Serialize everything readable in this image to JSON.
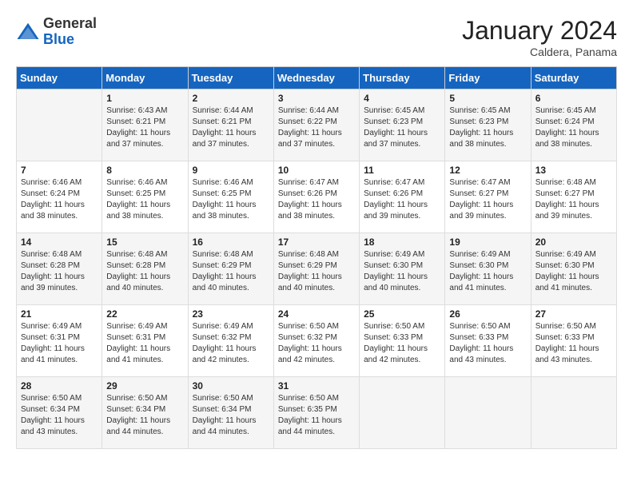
{
  "logo": {
    "general": "General",
    "blue": "Blue"
  },
  "title": "January 2024",
  "subtitle": "Caldera, Panama",
  "days_of_week": [
    "Sunday",
    "Monday",
    "Tuesday",
    "Wednesday",
    "Thursday",
    "Friday",
    "Saturday"
  ],
  "weeks": [
    [
      {
        "day": "",
        "sunrise": "",
        "sunset": "",
        "daylight": ""
      },
      {
        "day": "1",
        "sunrise": "Sunrise: 6:43 AM",
        "sunset": "Sunset: 6:21 PM",
        "daylight": "Daylight: 11 hours and 37 minutes."
      },
      {
        "day": "2",
        "sunrise": "Sunrise: 6:44 AM",
        "sunset": "Sunset: 6:21 PM",
        "daylight": "Daylight: 11 hours and 37 minutes."
      },
      {
        "day": "3",
        "sunrise": "Sunrise: 6:44 AM",
        "sunset": "Sunset: 6:22 PM",
        "daylight": "Daylight: 11 hours and 37 minutes."
      },
      {
        "day": "4",
        "sunrise": "Sunrise: 6:45 AM",
        "sunset": "Sunset: 6:23 PM",
        "daylight": "Daylight: 11 hours and 37 minutes."
      },
      {
        "day": "5",
        "sunrise": "Sunrise: 6:45 AM",
        "sunset": "Sunset: 6:23 PM",
        "daylight": "Daylight: 11 hours and 38 minutes."
      },
      {
        "day": "6",
        "sunrise": "Sunrise: 6:45 AM",
        "sunset": "Sunset: 6:24 PM",
        "daylight": "Daylight: 11 hours and 38 minutes."
      }
    ],
    [
      {
        "day": "7",
        "sunrise": "Sunrise: 6:46 AM",
        "sunset": "Sunset: 6:24 PM",
        "daylight": "Daylight: 11 hours and 38 minutes."
      },
      {
        "day": "8",
        "sunrise": "Sunrise: 6:46 AM",
        "sunset": "Sunset: 6:25 PM",
        "daylight": "Daylight: 11 hours and 38 minutes."
      },
      {
        "day": "9",
        "sunrise": "Sunrise: 6:46 AM",
        "sunset": "Sunset: 6:25 PM",
        "daylight": "Daylight: 11 hours and 38 minutes."
      },
      {
        "day": "10",
        "sunrise": "Sunrise: 6:47 AM",
        "sunset": "Sunset: 6:26 PM",
        "daylight": "Daylight: 11 hours and 38 minutes."
      },
      {
        "day": "11",
        "sunrise": "Sunrise: 6:47 AM",
        "sunset": "Sunset: 6:26 PM",
        "daylight": "Daylight: 11 hours and 39 minutes."
      },
      {
        "day": "12",
        "sunrise": "Sunrise: 6:47 AM",
        "sunset": "Sunset: 6:27 PM",
        "daylight": "Daylight: 11 hours and 39 minutes."
      },
      {
        "day": "13",
        "sunrise": "Sunrise: 6:48 AM",
        "sunset": "Sunset: 6:27 PM",
        "daylight": "Daylight: 11 hours and 39 minutes."
      }
    ],
    [
      {
        "day": "14",
        "sunrise": "Sunrise: 6:48 AM",
        "sunset": "Sunset: 6:28 PM",
        "daylight": "Daylight: 11 hours and 39 minutes."
      },
      {
        "day": "15",
        "sunrise": "Sunrise: 6:48 AM",
        "sunset": "Sunset: 6:28 PM",
        "daylight": "Daylight: 11 hours and 40 minutes."
      },
      {
        "day": "16",
        "sunrise": "Sunrise: 6:48 AM",
        "sunset": "Sunset: 6:29 PM",
        "daylight": "Daylight: 11 hours and 40 minutes."
      },
      {
        "day": "17",
        "sunrise": "Sunrise: 6:48 AM",
        "sunset": "Sunset: 6:29 PM",
        "daylight": "Daylight: 11 hours and 40 minutes."
      },
      {
        "day": "18",
        "sunrise": "Sunrise: 6:49 AM",
        "sunset": "Sunset: 6:30 PM",
        "daylight": "Daylight: 11 hours and 40 minutes."
      },
      {
        "day": "19",
        "sunrise": "Sunrise: 6:49 AM",
        "sunset": "Sunset: 6:30 PM",
        "daylight": "Daylight: 11 hours and 41 minutes."
      },
      {
        "day": "20",
        "sunrise": "Sunrise: 6:49 AM",
        "sunset": "Sunset: 6:30 PM",
        "daylight": "Daylight: 11 hours and 41 minutes."
      }
    ],
    [
      {
        "day": "21",
        "sunrise": "Sunrise: 6:49 AM",
        "sunset": "Sunset: 6:31 PM",
        "daylight": "Daylight: 11 hours and 41 minutes."
      },
      {
        "day": "22",
        "sunrise": "Sunrise: 6:49 AM",
        "sunset": "Sunset: 6:31 PM",
        "daylight": "Daylight: 11 hours and 41 minutes."
      },
      {
        "day": "23",
        "sunrise": "Sunrise: 6:49 AM",
        "sunset": "Sunset: 6:32 PM",
        "daylight": "Daylight: 11 hours and 42 minutes."
      },
      {
        "day": "24",
        "sunrise": "Sunrise: 6:50 AM",
        "sunset": "Sunset: 6:32 PM",
        "daylight": "Daylight: 11 hours and 42 minutes."
      },
      {
        "day": "25",
        "sunrise": "Sunrise: 6:50 AM",
        "sunset": "Sunset: 6:33 PM",
        "daylight": "Daylight: 11 hours and 42 minutes."
      },
      {
        "day": "26",
        "sunrise": "Sunrise: 6:50 AM",
        "sunset": "Sunset: 6:33 PM",
        "daylight": "Daylight: 11 hours and 43 minutes."
      },
      {
        "day": "27",
        "sunrise": "Sunrise: 6:50 AM",
        "sunset": "Sunset: 6:33 PM",
        "daylight": "Daylight: 11 hours and 43 minutes."
      }
    ],
    [
      {
        "day": "28",
        "sunrise": "Sunrise: 6:50 AM",
        "sunset": "Sunset: 6:34 PM",
        "daylight": "Daylight: 11 hours and 43 minutes."
      },
      {
        "day": "29",
        "sunrise": "Sunrise: 6:50 AM",
        "sunset": "Sunset: 6:34 PM",
        "daylight": "Daylight: 11 hours and 44 minutes."
      },
      {
        "day": "30",
        "sunrise": "Sunrise: 6:50 AM",
        "sunset": "Sunset: 6:34 PM",
        "daylight": "Daylight: 11 hours and 44 minutes."
      },
      {
        "day": "31",
        "sunrise": "Sunrise: 6:50 AM",
        "sunset": "Sunset: 6:35 PM",
        "daylight": "Daylight: 11 hours and 44 minutes."
      },
      {
        "day": "",
        "sunrise": "",
        "sunset": "",
        "daylight": ""
      },
      {
        "day": "",
        "sunrise": "",
        "sunset": "",
        "daylight": ""
      },
      {
        "day": "",
        "sunrise": "",
        "sunset": "",
        "daylight": ""
      }
    ]
  ]
}
